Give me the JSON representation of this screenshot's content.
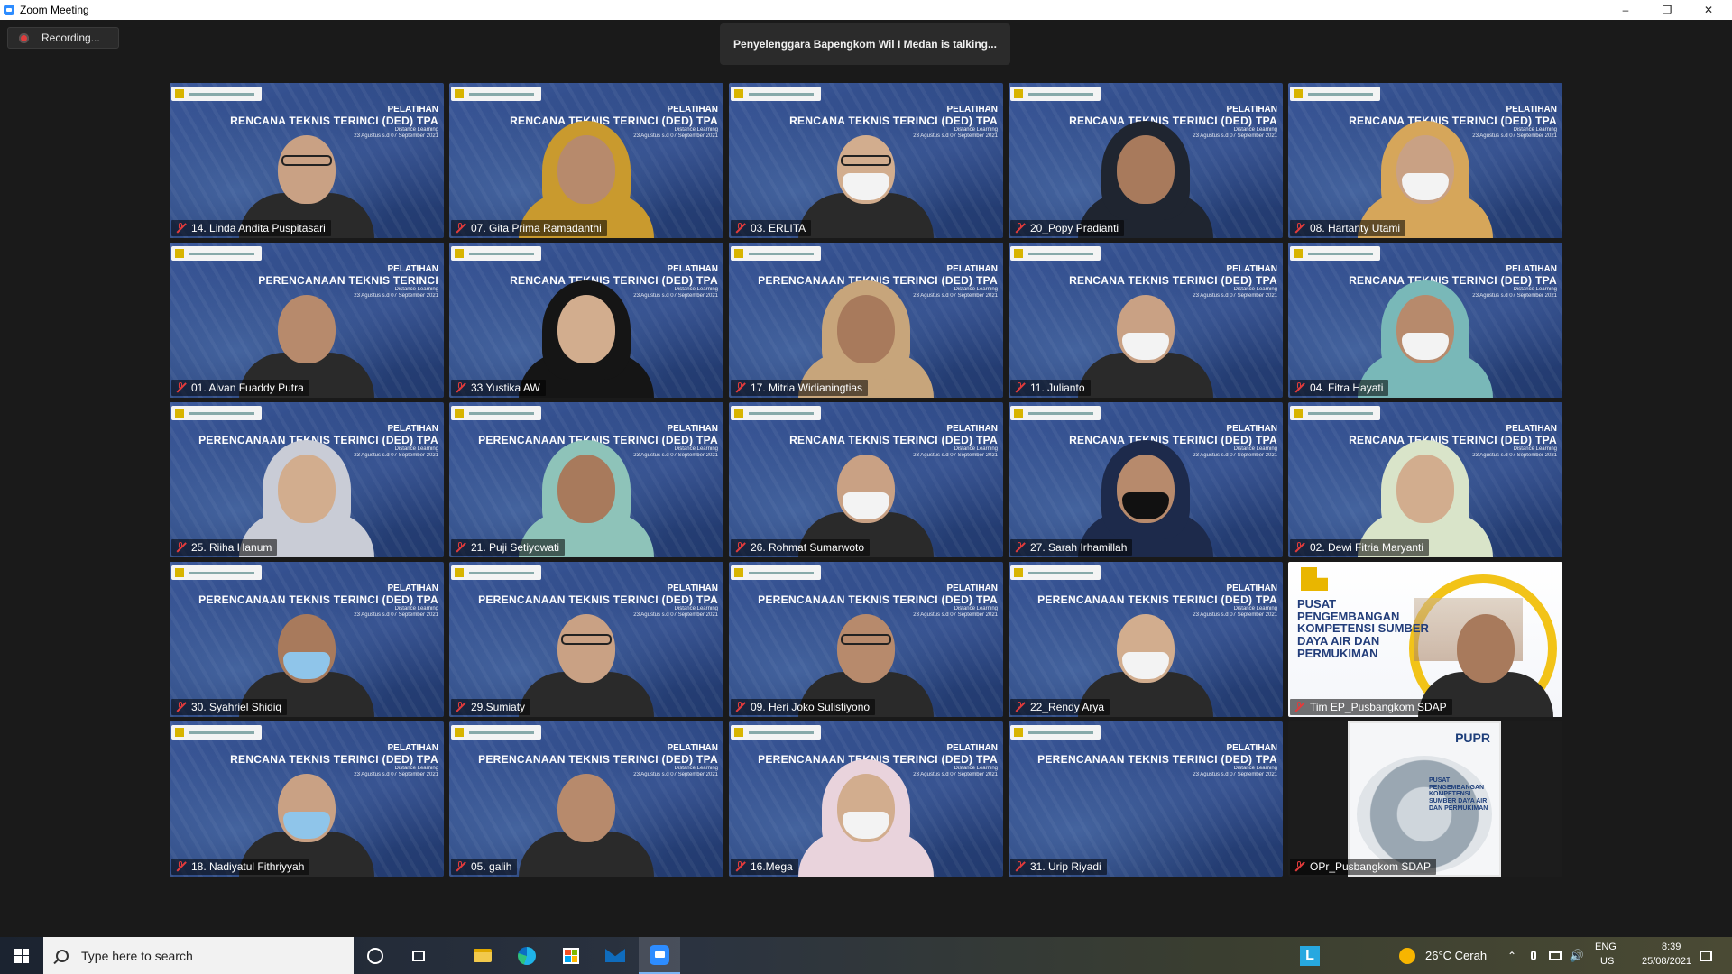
{
  "window": {
    "title": "Zoom Meeting",
    "minimize": "–",
    "restore": "❐",
    "close": "✕"
  },
  "meeting": {
    "recording_label": "Recording...",
    "talking_banner": "Penyelenggara Bapengkom Wil I Medan is talking..."
  },
  "slide": {
    "line1": "PELATIHAN",
    "line3": "Distance Learning",
    "line4": "23 Agustus s.d 07 September 2021"
  },
  "participants": [
    {
      "name": "14. Linda Andita Puspitasari",
      "slide_title": "RENCANA TEKNIS TERINCI (DED) TPA",
      "look": "glasses"
    },
    {
      "name": "07. Gita Prima Ramadanthi",
      "slide_title": "RENCANA TEKNIS TERINCI (DED) TPA",
      "look": "hijab-yellow"
    },
    {
      "name": "03. ERLITA",
      "slide_title": "RENCANA TEKNIS TERINCI (DED) TPA",
      "look": "mask-headset"
    },
    {
      "name": "20_Popy Pradianti",
      "slide_title": "RENCANA TEKNIS TERINCI (DED) TPA",
      "look": "hijab-dark"
    },
    {
      "name": "08. Hartanty Utami",
      "slide_title": "RENCANA TEKNIS TERINCI (DED) TPA",
      "look": "hijab-mask"
    },
    {
      "name": "01. Alvan Fuaddy Putra",
      "slide_title": "PERENCANAAN TEKNIS TERINCI",
      "look": "room"
    },
    {
      "name": "33 Yustika AW",
      "slide_title": "RENCANA TEKNIS TERINCI (DED) TPA",
      "look": "hijab-black"
    },
    {
      "name": "17. Mitria Widianingtias",
      "slide_title": "PERENCANAAN TEKNIS TERINCI (DED) TPA",
      "look": "hijab-beige"
    },
    {
      "name": "11. Julianto",
      "slide_title": "RENCANA TEKNIS TERINCI (DED) TPA",
      "look": "mask"
    },
    {
      "name": "04. Fitra Hayati",
      "slide_title": "RENCANA TEKNIS TERINCI (DED) TPA",
      "look": "hijab-teal-mask"
    },
    {
      "name": "25. Riiha Hanum",
      "slide_title": "PERENCANAAN TEKNIS TERINCI (DED) TPA",
      "look": "hijab-grey"
    },
    {
      "name": "21. Puji Setiyowati",
      "slide_title": "PERENCANAAN TEKNIS TERINCI (DED) TPA",
      "look": "hijab-teal"
    },
    {
      "name": "26. Rohmat Sumarwoto",
      "slide_title": "RENCANA TEKNIS TERINCI (DED) TPA",
      "look": "mask"
    },
    {
      "name": "27. Sarah Irhamillah",
      "slide_title": "RENCANA TEKNIS TERINCI (DED) TPA",
      "look": "hijab-navy-mask"
    },
    {
      "name": "02. Dewi Fitria Maryanti",
      "slide_title": "RENCANA TEKNIS TERINCI (DED) TPA",
      "look": "hijab-floral"
    },
    {
      "name": "30. Syahriel Shidiq",
      "slide_title": "PERENCANAAN TEKNIS TERINCI (DED) TPA",
      "look": "mask-blue"
    },
    {
      "name": "29.Sumiaty",
      "slide_title": "PERENCANAAN TEKNIS TERINCI (DED) TPA",
      "look": "glasses"
    },
    {
      "name": "09. Heri Joko Sulistiyono",
      "slide_title": "PERENCANAAN TEKNIS TERINCI (DED) TPA",
      "look": "glasses"
    },
    {
      "name": "22_Rendy Arya",
      "slide_title": "PERENCANAAN TEKNIS TERINCI (DED) TPA",
      "look": "mask"
    },
    {
      "name": "Tim EP_Pusbangkom SDAP",
      "slide_title": "PUSAT PENGEMBANGAN KOMPETENSI SUMBER DAYA AIR DAN PERMUKIMAN",
      "look": "pusat"
    },
    {
      "name": "18. Nadiyatul Fithriyyah",
      "slide_title": "RENCANA TEKNIS TERINCI (DED) TPA",
      "look": "mask-blue"
    },
    {
      "name": "05. galih",
      "slide_title": "PERENCANAAN TEKNIS TERINCI (DED) TPA",
      "look": "plain"
    },
    {
      "name": "16.Mega",
      "slide_title": "PERENCANAAN TEKNIS TERINCI (DED) TPA",
      "look": "hijab-pink-mask"
    },
    {
      "name": "31. Urip Riyadi",
      "slide_title": "PERENCANAAN TEKNIS TERINCI (DED) TPA",
      "look": "none"
    },
    {
      "name": "OPr_Pusbangkom SDAP",
      "slide_title": "PUSAT PENGEMBANGAN KOMPETENSI SUMBER DAYA AIR DAN PERMUKIMAN",
      "look": "opr",
      "brand": "PUPR"
    }
  ],
  "taskbar": {
    "search_placeholder": "Type here to search",
    "weather": "26°C  Cerah",
    "language_top": "ENG",
    "language_bottom": "US",
    "time": "8:39",
    "date": "25/08/2021",
    "pinned_app_letter": "L"
  },
  "colors": {
    "slide_blue": "#2a4580",
    "zoom_blue": "#2d8cff",
    "muted_red": "#e23b3b"
  }
}
